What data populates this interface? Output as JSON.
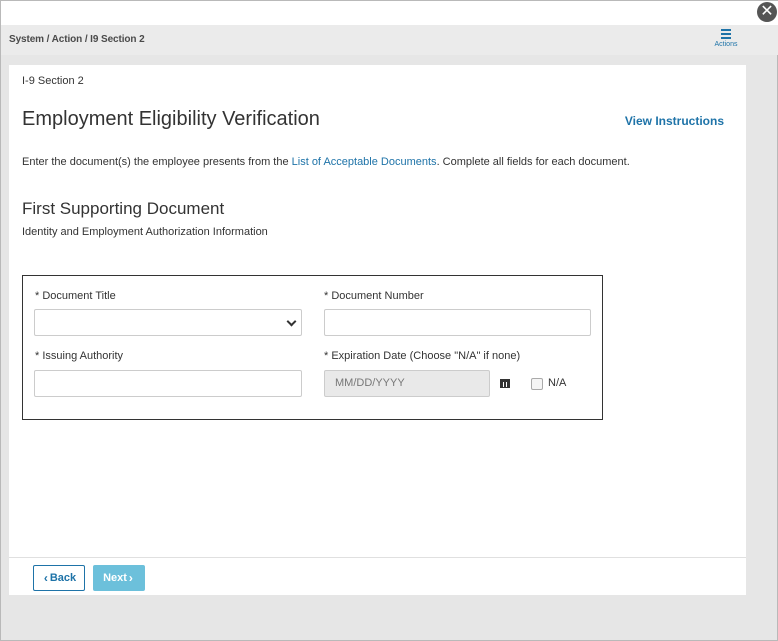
{
  "window": {
    "close_icon": "close-icon"
  },
  "header": {
    "breadcrumb": "System / Action / I9 Section 2",
    "actions_label": "Actions"
  },
  "panel": {
    "section_label": "I-9 Section 2",
    "title": "Employment Eligibility Verification",
    "view_instructions": "View Instructions",
    "instruction_pre": "Enter the document(s) the employee presents from the ",
    "instruction_link": "List of Acceptable Documents",
    "instruction_post": ". Complete all fields for each document.",
    "sub_title": "First Supporting Document",
    "sub_desc": "Identity and Employment Authorization Information"
  },
  "form": {
    "document_title_label": "* Document Title",
    "document_title_value": "",
    "document_number_label": "* Document Number",
    "document_number_value": "",
    "issuing_authority_label": "* Issuing Authority",
    "issuing_authority_value": "",
    "expiration_label": "* Expiration Date (Choose \"N/A\" if none)",
    "expiration_placeholder": "MM/DD/YYYY",
    "na_label": "N/A",
    "na_checked": false
  },
  "footer": {
    "back_label": "Back",
    "next_label": "Next"
  },
  "colors": {
    "link": "#1e73a8",
    "next_button": "#6cc0db"
  }
}
